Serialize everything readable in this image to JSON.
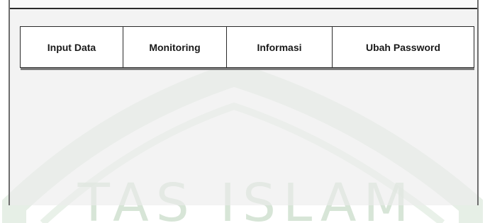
{
  "navbar": {
    "items": [
      {
        "label": "Input Data"
      },
      {
        "label": "Monitoring"
      },
      {
        "label": "Informasi"
      },
      {
        "label": "Ubah Password"
      }
    ]
  },
  "watermark": {
    "text": "TAS ISLAM",
    "color": "#c9dcc9"
  }
}
